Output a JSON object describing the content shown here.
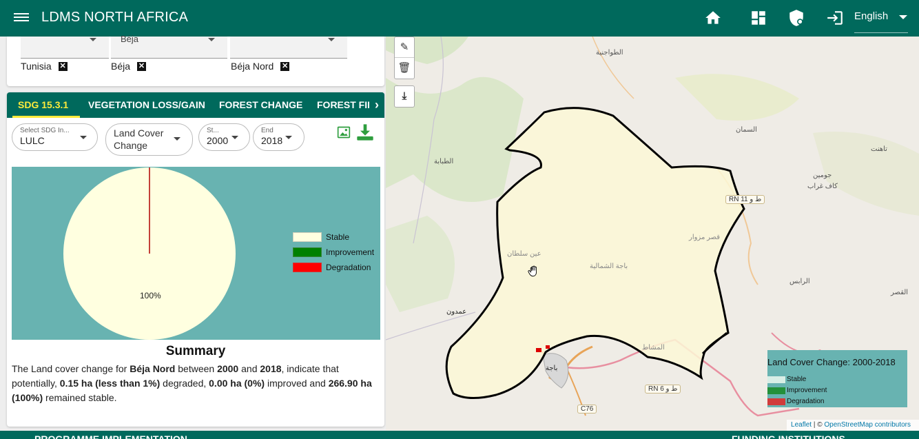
{
  "header": {
    "title": "LDMS NORTH AFRICA",
    "language": "English",
    "icons": [
      "menu-icon",
      "home-icon",
      "dashboard-icon",
      "shield-icon",
      "login-icon"
    ]
  },
  "filters": {
    "country_value": "",
    "governorate_value": "Béja",
    "delegation_value": "",
    "chips": [
      "Tunisia",
      "Béja",
      "Béja Nord"
    ]
  },
  "tabs": [
    "SDG 15.3.1",
    "VEGETATION LOSS/GAIN",
    "FOREST CHANGE",
    "FOREST FIRE"
  ],
  "controls": {
    "sdg_label": "Select SDG In...",
    "sdg_value": "LULC",
    "type_value": "Land Cover Change",
    "start_label": "St...",
    "start_value": "2000",
    "end_label": "End",
    "end_value": "2018"
  },
  "chart_data": {
    "type": "pie",
    "categories": [
      "Stable",
      "Improvement",
      "Degradation"
    ],
    "values": [
      100,
      0,
      0.001
    ],
    "data_label": "100%",
    "legend_position": "right",
    "colors": {
      "Stable": "#ffffe0",
      "Improvement": "#008000",
      "Degradation": "#ff0000"
    }
  },
  "summary": {
    "title": "Summary",
    "t1": "The Land cover change for ",
    "area": "Béja Nord",
    "t2": " between ",
    "start": "2000",
    "t3": " and ",
    "end": "2018",
    "t4": ", indicate that potentially, ",
    "degraded": "0.15 ha (less than 1%)",
    "t5": " degraded, ",
    "improved": "0.00 ha (0%)",
    "t6": " improved and ",
    "stable": "266.90 ha (100%)",
    "t7": " remained stable."
  },
  "map": {
    "legend_title": "Land Cover Change: 2000-2018",
    "legend_items": [
      "Stable",
      "Improvement",
      "Degradation"
    ],
    "legend_colors": [
      "#d8eee6",
      "#23903a",
      "#d13b3b"
    ],
    "place_labels": [
      "الطواجنية",
      "السمان",
      "تاهنت",
      "جومين",
      "كاف غراب",
      "الطبابة",
      "عين سلطان",
      "قصر مزوار",
      "باجة الشمالية",
      "الرابس",
      "القصر",
      "عمدون",
      "باجة",
      "المشاط"
    ],
    "road_labels": [
      "RN 11 ط و",
      "RN 6 ط و",
      "C76"
    ],
    "attribution_leaflet": "Leaflet",
    "attribution_osm": "OpenStreetMap contributors"
  },
  "footer": {
    "left_text": "PROGRAMME IMPLEMENTATION",
    "right_text": "FUNDING INSTITUTIONS"
  }
}
